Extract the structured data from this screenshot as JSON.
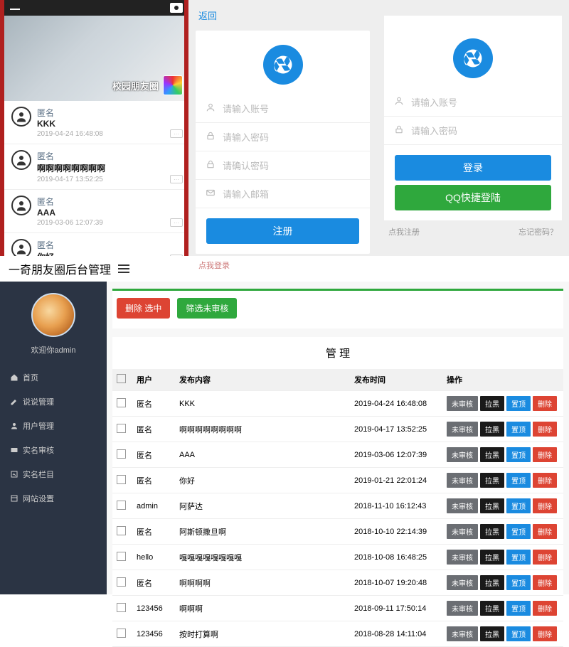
{
  "panel1": {
    "hero_text": "校园朋友圈",
    "items": [
      {
        "name": "匿名",
        "content": "KKK",
        "time": "2019-04-24 16:48:08"
      },
      {
        "name": "匿名",
        "content": "啊啊啊啊啊啊啊啊",
        "time": "2019-04-17 13:52:25"
      },
      {
        "name": "匿名",
        "content": "AAA",
        "time": "2019-03-06 12:07:39"
      },
      {
        "name": "匿名",
        "content": "你好",
        "time": ""
      }
    ]
  },
  "panel2": {
    "back": "返回",
    "username_ph": "请输入账号",
    "password_ph": "请输入密码",
    "confirm_ph": "请确认密码",
    "email_ph": "请输入邮箱",
    "submit": "注册",
    "foot_link": "点我登录"
  },
  "panel3": {
    "username_ph": "请输入账号",
    "password_ph": "请输入密码",
    "login": "登录",
    "qq": "QQ快捷登陆",
    "foot_left": "点我注册",
    "foot_right": "忘记密码？"
  },
  "admin": {
    "title": "一奇朋友圈后台管理",
    "welcome": "欢迎你admin",
    "nav": [
      "首页",
      "说说管理",
      "用户管理",
      "实名审核",
      "实名栏目",
      "网站设置"
    ],
    "nav_icons": [
      "home-icon",
      "edit-icon",
      "user-icon",
      "id-card-icon",
      "edit-square-icon",
      "layout-icon"
    ],
    "btn_delete": "删除 选中",
    "btn_filter": "筛选未审核",
    "panel_title": "管 理",
    "cols": {
      "user": "用户",
      "content": "发布内容",
      "time": "发布时间",
      "ops": "操作"
    },
    "op_labels": {
      "review": "未审核",
      "block": "拉黑",
      "pin": "置顶",
      "del": "删除"
    },
    "rows": [
      {
        "user": "匿名",
        "content": "KKK",
        "time": "2019-04-24 16:48:08"
      },
      {
        "user": "匿名",
        "content": "啊啊啊啊啊啊啊啊",
        "time": "2019-04-17 13:52:25"
      },
      {
        "user": "匿名",
        "content": "AAA",
        "time": "2019-03-06 12:07:39"
      },
      {
        "user": "匿名",
        "content": "你好",
        "time": "2019-01-21 22:01:24"
      },
      {
        "user": "admin",
        "content": "阿萨达",
        "time": "2018-11-10 16:12:43"
      },
      {
        "user": "匿名",
        "content": "阿斯顿撒旦啊",
        "time": "2018-10-10 22:14:39"
      },
      {
        "user": "hello",
        "content": "嘎嘎嘎嘎嘎嘎嘎嘎",
        "time": "2018-10-08 16:48:25"
      },
      {
        "user": "匿名",
        "content": "啊啊啊啊",
        "time": "2018-10-07 19:20:48"
      },
      {
        "user": "123456",
        "content": "啊啊啊",
        "time": "2018-09-11 17:50:14"
      },
      {
        "user": "123456",
        "content": "按时打算啊",
        "time": "2018-08-28 14:11:04"
      }
    ]
  }
}
